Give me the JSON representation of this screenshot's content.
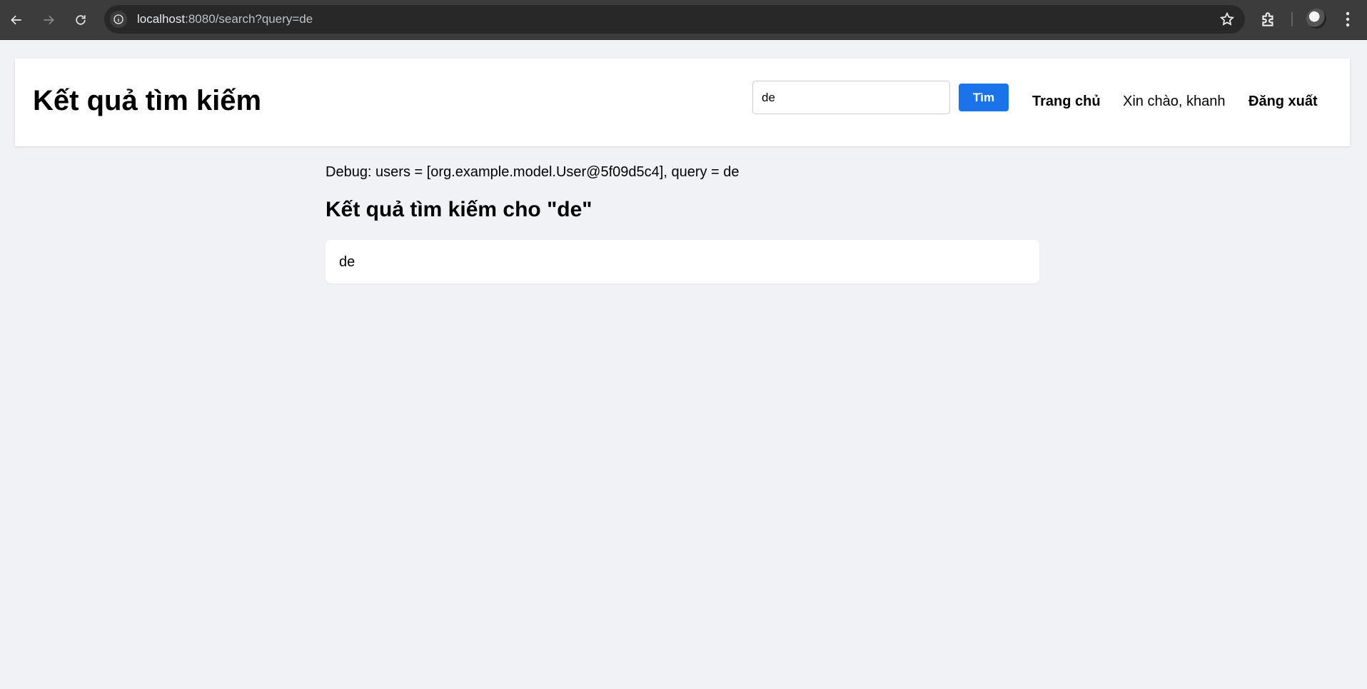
{
  "browser": {
    "url_host": "localhost",
    "url_path": ":8080/search?query=de"
  },
  "header": {
    "title": "Kết quả tìm kiếm",
    "search_value": "de",
    "search_button": "Tìm",
    "nav_home": "Trang chủ",
    "greeting": "Xin chào, khanh",
    "logout": "Đăng xuất"
  },
  "main": {
    "debug": "Debug: users = [org.example.model.User@5f09d5c4], query = de",
    "results_heading": "Kết quả tìm kiếm cho \"de\"",
    "results": [
      {
        "text": "de"
      }
    ]
  },
  "colors": {
    "accent": "#1a73e8",
    "page_bg": "#f0f2f5",
    "chrome_bg": "#3c3c3c"
  },
  "icons": {
    "back": "arrow-left-icon",
    "forward": "arrow-right-icon",
    "reload": "reload-icon",
    "site_info": "info-icon",
    "bookmark": "star-icon",
    "extensions": "puzzle-icon",
    "profile": "avatar",
    "menu": "kebab-menu-icon"
  }
}
